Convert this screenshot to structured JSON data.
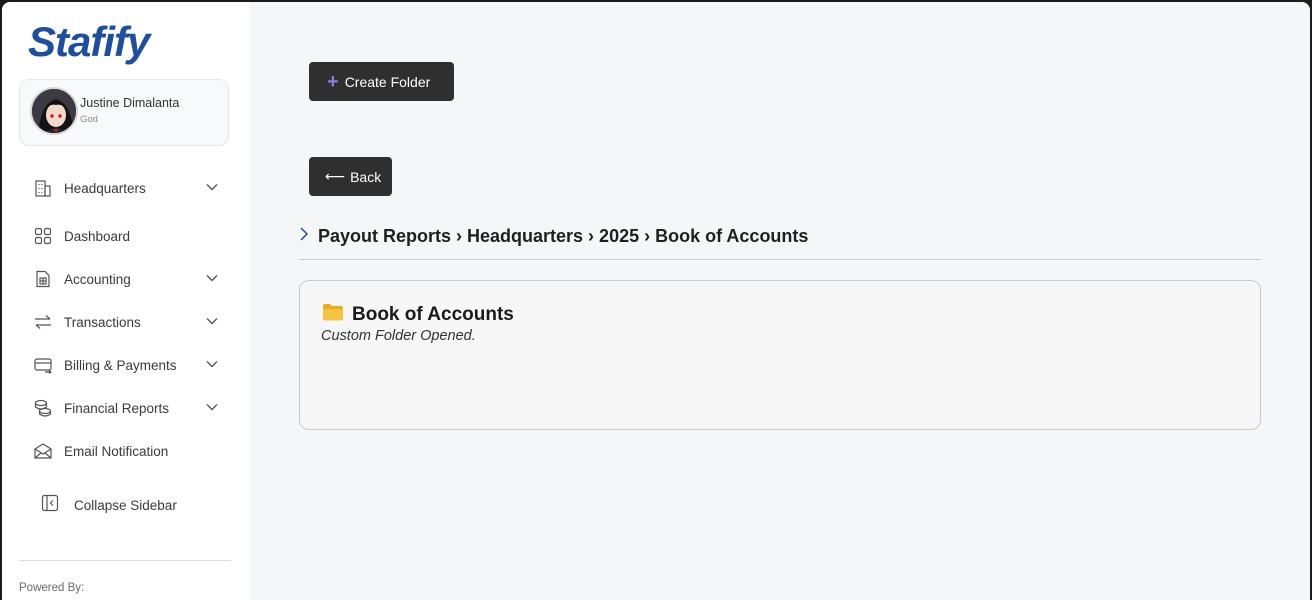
{
  "app": {
    "logo": "Stafify"
  },
  "profile": {
    "name": "Justine Dimalanta",
    "role": "God"
  },
  "sidebar": {
    "items": [
      {
        "label": "Headquarters",
        "icon": "building-icon",
        "expandable": true
      },
      {
        "label": "Dashboard",
        "icon": "grid-icon",
        "expandable": false
      },
      {
        "label": "Accounting",
        "icon": "calculator-icon",
        "expandable": true
      },
      {
        "label": "Transactions",
        "icon": "swap-arrows-icon",
        "expandable": true
      },
      {
        "label": "Billing & Payments",
        "icon": "card-icon",
        "expandable": true
      },
      {
        "label": "Financial Reports",
        "icon": "coins-icon",
        "expandable": true
      },
      {
        "label": "Email Notification",
        "icon": "envelope-icon",
        "expandable": false
      }
    ],
    "collapse_label": "Collapse Sidebar",
    "powered_by": "Powered By:"
  },
  "toolbar": {
    "create_folder_label": "Create Folder",
    "back_label": "Back"
  },
  "breadcrumb": {
    "text": "Payout Reports › Headquarters › 2025 › Book of Accounts"
  },
  "folder": {
    "title": "Book of Accounts",
    "subtitle": "Custom Folder Opened."
  },
  "colors": {
    "logo": "#1f4e9b",
    "button_bg": "#2f2f2f",
    "plus_accent": "#8b7fd6",
    "folder": "#f5c542"
  }
}
